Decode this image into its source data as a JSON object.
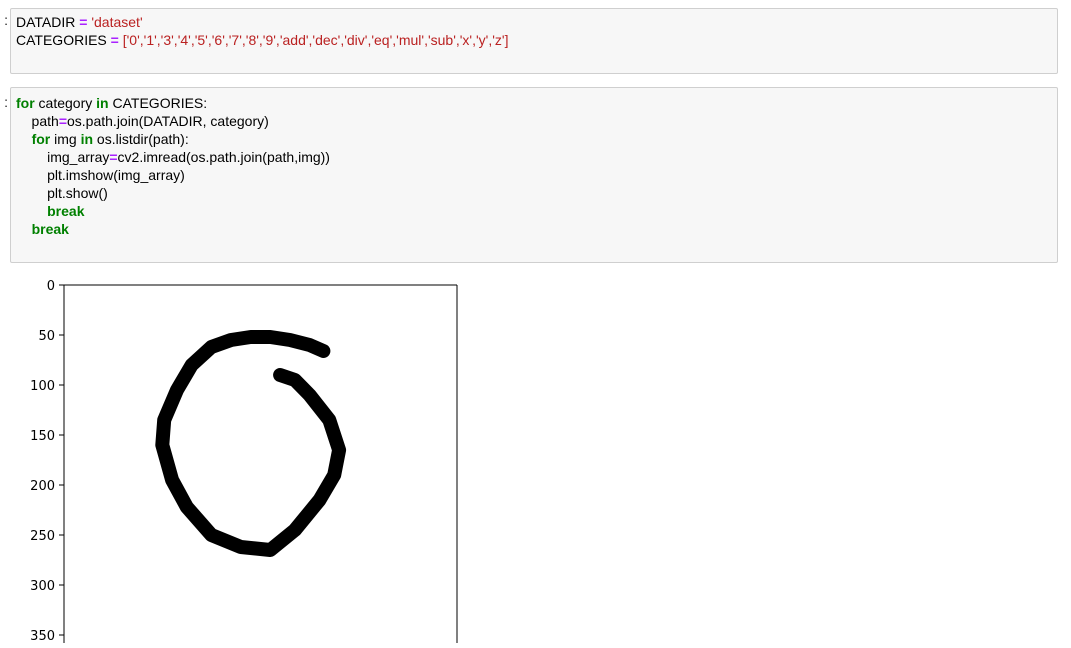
{
  "cells": [
    {
      "prompt": ":",
      "lines": [
        [
          {
            "t": "DATADIR ",
            "c": "nm"
          },
          {
            "t": "=",
            "c": "op"
          },
          {
            "t": " ",
            "c": "nm"
          },
          {
            "t": "'dataset'",
            "c": "str"
          }
        ],
        [
          {
            "t": "CATEGORIES ",
            "c": "nm"
          },
          {
            "t": "=",
            "c": "op"
          },
          {
            "t": " ",
            "c": "nm"
          },
          {
            "t": "['0','1','3','4','5','6','7','8','9','add','dec','div','eq','mul','sub','x','y','z']",
            "c": "str"
          }
        ]
      ]
    },
    {
      "prompt": ":",
      "lines": [
        [
          {
            "t": "for",
            "c": "kw"
          },
          {
            "t": " category ",
            "c": "nm"
          },
          {
            "t": "in",
            "c": "kw"
          },
          {
            "t": " CATEGORIES:",
            "c": "nm"
          }
        ],
        [
          {
            "t": "    path",
            "c": "nm"
          },
          {
            "t": "=",
            "c": "op"
          },
          {
            "t": "os.path.join(DATADIR, category)",
            "c": "nm"
          }
        ],
        [
          {
            "t": "    ",
            "c": "nm"
          },
          {
            "t": "for",
            "c": "kw"
          },
          {
            "t": " img ",
            "c": "nm"
          },
          {
            "t": "in",
            "c": "kw"
          },
          {
            "t": " os.listdir(path):",
            "c": "nm"
          }
        ],
        [
          {
            "t": "        img_array",
            "c": "nm"
          },
          {
            "t": "=",
            "c": "op"
          },
          {
            "t": "cv2.imread(os.path.join(path,img))",
            "c": "nm"
          }
        ],
        [
          {
            "t": "        plt.imshow(img_array)",
            "c": "nm"
          }
        ],
        [
          {
            "t": "        plt.show()",
            "c": "nm"
          }
        ],
        [
          {
            "t": "        ",
            "c": "nm"
          },
          {
            "t": "break",
            "c": "kw"
          }
        ],
        [
          {
            "t": "    ",
            "c": "nm"
          },
          {
            "t": "break",
            "c": "kw"
          }
        ]
      ]
    }
  ],
  "chart_data": {
    "type": "image",
    "title": "",
    "xlabel": "",
    "ylabel": "",
    "y_ticks": [
      0,
      50,
      100,
      150,
      200,
      250,
      300,
      350
    ],
    "ylim": [
      0,
      363
    ],
    "xlim": [
      0,
      400
    ],
    "image_content": "handwritten digit six drawn as black stroke on white",
    "stroke_points": [
      [
        264,
        66
      ],
      [
        250,
        60
      ],
      [
        230,
        55
      ],
      [
        210,
        52
      ],
      [
        190,
        52
      ],
      [
        170,
        55
      ],
      [
        150,
        62
      ],
      [
        130,
        80
      ],
      [
        115,
        105
      ],
      [
        102,
        135
      ],
      [
        100,
        160
      ],
      [
        110,
        195
      ],
      [
        125,
        222
      ],
      [
        150,
        250
      ],
      [
        180,
        262
      ],
      [
        210,
        265
      ],
      [
        235,
        245
      ],
      [
        260,
        215
      ],
      [
        275,
        190
      ],
      [
        280,
        165
      ],
      [
        270,
        135
      ],
      [
        250,
        110
      ],
      [
        235,
        95
      ],
      [
        220,
        90
      ]
    ],
    "colors": {
      "stroke": "#000000",
      "background": "#ffffff",
      "axis": "#000000"
    }
  }
}
